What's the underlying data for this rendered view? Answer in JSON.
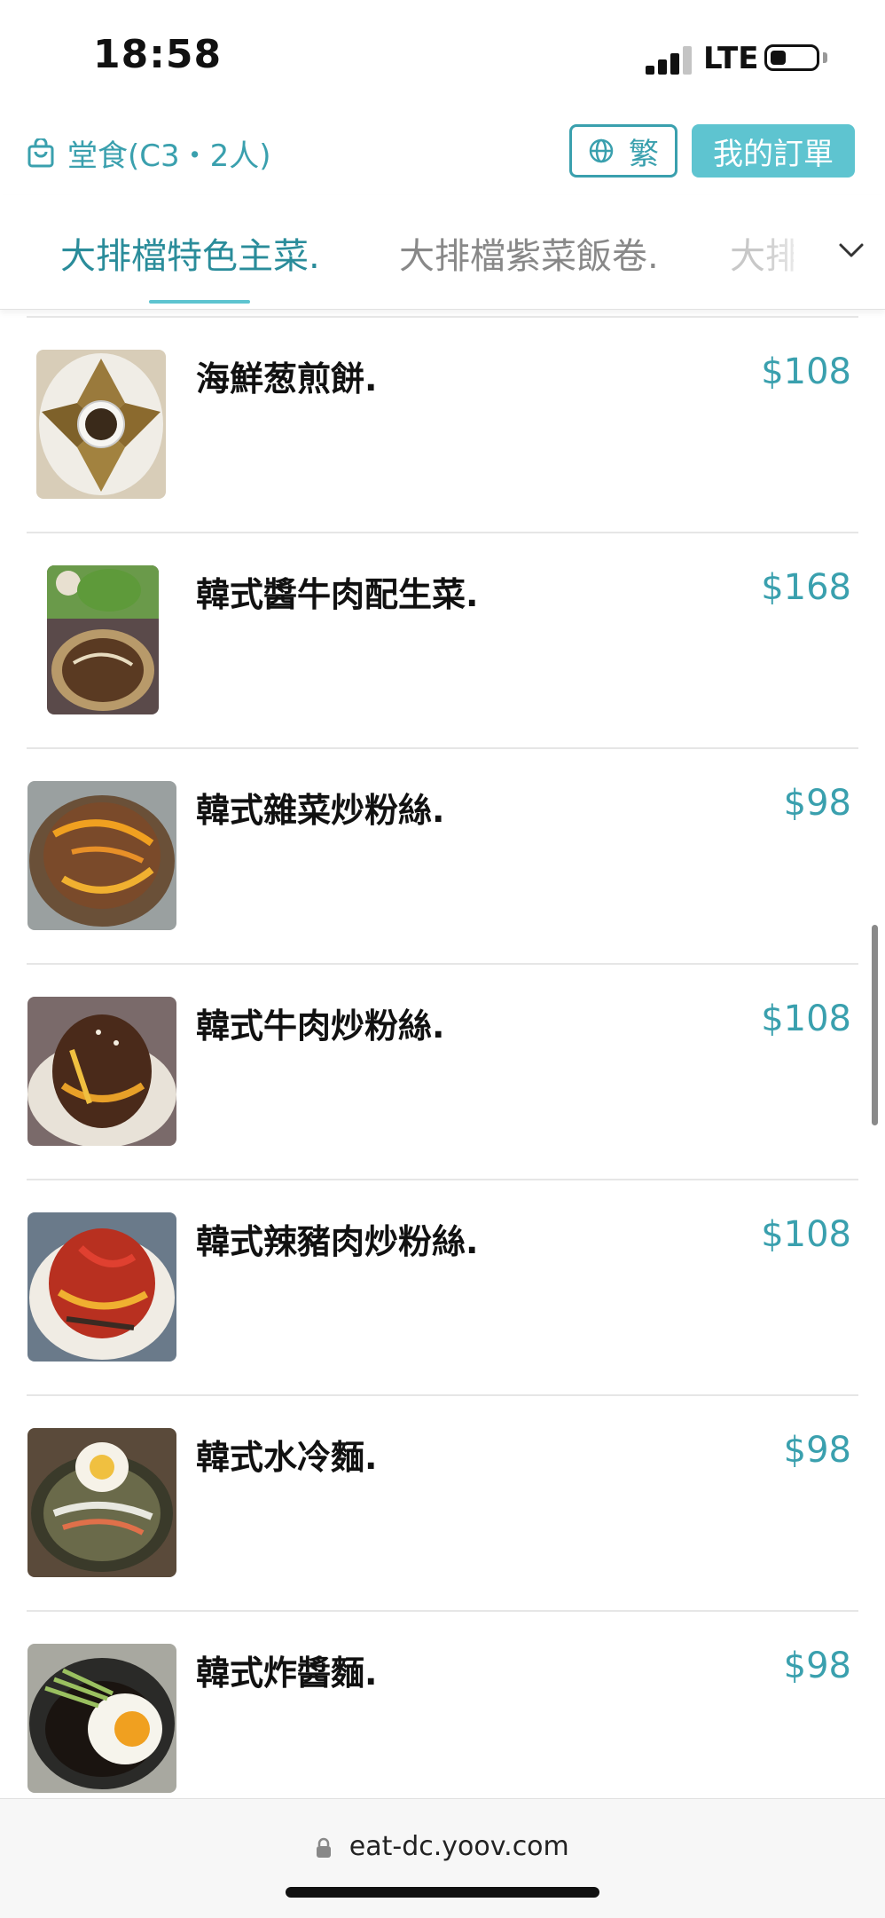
{
  "status_bar": {
    "time": "18:58",
    "network": "LTE",
    "battery_level": 0.35
  },
  "header": {
    "dine_in_label": "堂食(C3・2人)",
    "language_label": "繁",
    "orders_label": "我的訂單"
  },
  "tabs": [
    {
      "label": "大排檔特色主菜.",
      "active": true
    },
    {
      "label": "大排檔紫菜飯卷.",
      "active": false
    },
    {
      "label": "大排",
      "active": false
    }
  ],
  "menu_items": [
    {
      "name": "海鮮葱煎餅.",
      "price": "$108",
      "image_icon": "seafood-pancake-photo"
    },
    {
      "name": "韓式醬牛肉配生菜.",
      "price": "$168",
      "image_icon": "braised-beef-lettuce-photo"
    },
    {
      "name": "韓式雜菜炒粉絲.",
      "price": "$98",
      "image_icon": "japchae-photo"
    },
    {
      "name": "韓式牛肉炒粉絲.",
      "price": "$108",
      "image_icon": "beef-japchae-photo"
    },
    {
      "name": "韓式辣豬肉炒粉絲.",
      "price": "$108",
      "image_icon": "spicy-pork-japchae-photo"
    },
    {
      "name": "韓式水冷麵.",
      "price": "$98",
      "image_icon": "cold-noodles-photo"
    },
    {
      "name": "韓式炸醬麵.",
      "price": "$98",
      "image_icon": "jajangmyeon-photo"
    }
  ],
  "browser": {
    "url": "eat-dc.yoov.com"
  },
  "colors": {
    "accent": "#3aa0ae",
    "button": "#5ec4d0"
  }
}
